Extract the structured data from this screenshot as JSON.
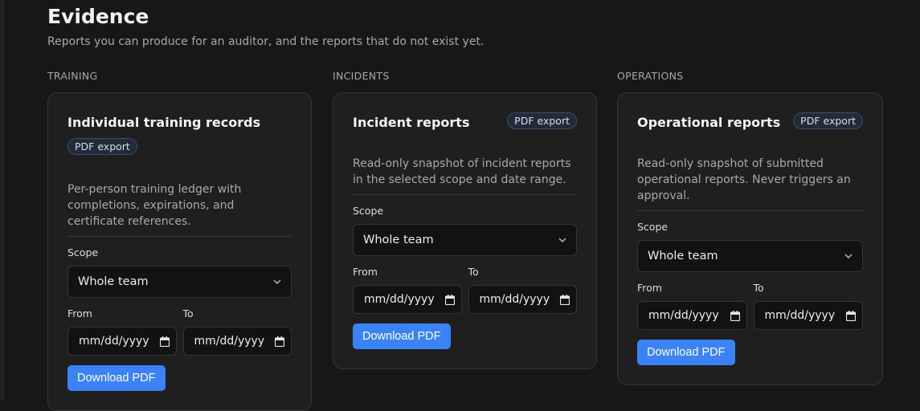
{
  "page": {
    "title": "Evidence",
    "subtitle": "Reports you can produce for an auditor, and the reports that do not exist yet."
  },
  "columns": [
    {
      "category": "TRAINING",
      "card": {
        "title": "Individual training records",
        "badge": "PDF export",
        "description": "Per-person training ledger with completions, expirations, and certificate references.",
        "scope_label": "Scope",
        "scope_value": "Whole team",
        "from_label": "From",
        "to_label": "To",
        "from_placeholder": "mm/dd/yyyy",
        "to_placeholder": "mm/dd/yyyy",
        "button": "Download PDF"
      }
    },
    {
      "category": "INCIDENTS",
      "card": {
        "title": "Incident reports",
        "badge": "PDF export",
        "description": "Read-only snapshot of incident reports in the selected scope and date range.",
        "scope_label": "Scope",
        "scope_value": "Whole team",
        "from_label": "From",
        "to_label": "To",
        "from_placeholder": "mm/dd/yyyy",
        "to_placeholder": "mm/dd/yyyy",
        "button": "Download PDF"
      }
    },
    {
      "category": "OPERATIONS",
      "card": {
        "title": "Operational reports",
        "badge": "PDF export",
        "description": "Read-only snapshot of submitted operational reports. Never triggers an approval.",
        "scope_label": "Scope",
        "scope_value": "Whole team",
        "from_label": "From",
        "to_label": "To",
        "from_placeholder": "mm/dd/yyyy",
        "to_placeholder": "mm/dd/yyyy",
        "button": "Download PDF"
      }
    }
  ],
  "icons": {
    "select_chevron": "chevron-down-icon",
    "date_picker": "calendar-icon"
  },
  "colors": {
    "accent": "#3b82f6",
    "background": "#171717",
    "card": "#1f1f1f"
  }
}
